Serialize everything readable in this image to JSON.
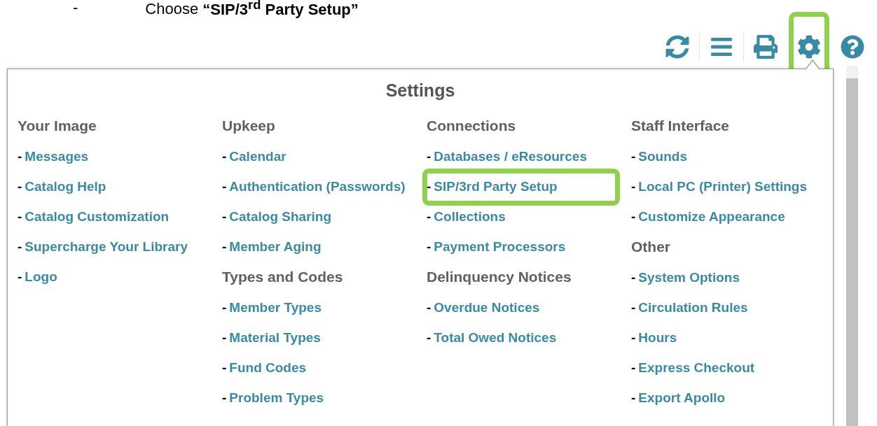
{
  "instruction": {
    "bullet": "-",
    "text": "Choose **“SIP/3$^{rd}$ Party Setup”**"
  },
  "toolbar": [
    {
      "kind": "refresh",
      "highlighted": false
    },
    {
      "kind": "menu",
      "highlighted": false
    },
    {
      "kind": "print",
      "highlighted": false
    },
    {
      "kind": "settings",
      "highlighted": true
    },
    {
      "kind": "help",
      "highlighted": false
    }
  ],
  "settings_panel": {
    "title": "Settings",
    "columns": [
      {
        "sections": [
          {
            "heading": "Your Image",
            "items": [
              {
                "bullet": "-",
                "label": "Messages",
                "highlighted": false
              },
              {
                "bullet": "-",
                "label": "Catalog Help",
                "highlighted": false
              },
              {
                "bullet": "-",
                "label": "Catalog Customization",
                "highlighted": false
              },
              {
                "bullet": "-",
                "label": "Supercharge Your Library",
                "highlighted": false
              },
              {
                "bullet": "-",
                "label": "Logo",
                "highlighted": false
              }
            ]
          }
        ]
      },
      {
        "sections": [
          {
            "heading": "Upkeep",
            "items": [
              {
                "bullet": "-",
                "label": "Calendar",
                "highlighted": false
              },
              {
                "bullet": "-",
                "label": "Authentication (Passwords)",
                "highlighted": false
              },
              {
                "bullet": "-",
                "label": "Catalog Sharing",
                "highlighted": false
              },
              {
                "bullet": "-",
                "label": "Member Aging",
                "highlighted": false
              }
            ]
          },
          {
            "heading": "Types and Codes",
            "items": [
              {
                "bullet": "-",
                "label": "Member Types",
                "highlighted": false
              },
              {
                "bullet": "-",
                "label": "Material Types",
                "highlighted": false
              },
              {
                "bullet": "-",
                "label": "Fund Codes",
                "highlighted": false
              },
              {
                "bullet": "-",
                "label": "Problem Types",
                "highlighted": false
              }
            ]
          }
        ]
      },
      {
        "sections": [
          {
            "heading": "Connections",
            "items": [
              {
                "bullet": "-",
                "label": "Databases / eResources",
                "highlighted": false
              },
              {
                "bullet": "-",
                "label": "SIP/3rd Party Setup",
                "highlighted": true
              },
              {
                "bullet": "-",
                "label": "Collections",
                "highlighted": false
              },
              {
                "bullet": "-",
                "label": "Payment Processors",
                "highlighted": false
              }
            ]
          },
          {
            "heading": "Delinquency Notices",
            "items": [
              {
                "bullet": "-",
                "label": "Overdue Notices",
                "highlighted": false
              },
              {
                "bullet": "-",
                "label": "Total Owed Notices",
                "highlighted": false
              }
            ]
          }
        ]
      },
      {
        "sections": [
          {
            "heading": "Staff Interface",
            "items": [
              {
                "bullet": "-",
                "label": "Sounds",
                "highlighted": false
              },
              {
                "bullet": "-",
                "label": "Local PC (Printer) Settings",
                "highlighted": false
              },
              {
                "bullet": "-",
                "label": "Customize Appearance",
                "highlighted": false
              }
            ]
          },
          {
            "heading": "Other",
            "items": [
              {
                "bullet": "-",
                "label": "System Options",
                "highlighted": false
              },
              {
                "bullet": "-",
                "label": "Circulation Rules",
                "highlighted": false
              },
              {
                "bullet": "-",
                "label": "Hours",
                "highlighted": false
              },
              {
                "bullet": "-",
                "label": "Express Checkout",
                "highlighted": false
              },
              {
                "bullet": "-",
                "label": "Export Apollo",
                "highlighted": false
              }
            ]
          }
        ]
      }
    ]
  }
}
